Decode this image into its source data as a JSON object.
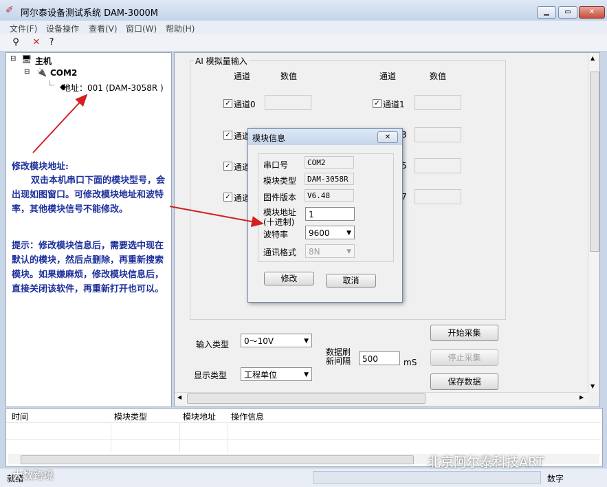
{
  "window": {
    "title": "阿尔泰设备测试系统 DAM-3000M"
  },
  "menu": [
    "文件(F)",
    "设备操作",
    "查看(V)",
    "窗口(W)",
    "帮助(H)"
  ],
  "tree": {
    "root": "主机",
    "port": "COM2",
    "device": "地址：001 (DAM-3058R )"
  },
  "annotation": {
    "title": "修改模块地址:",
    "body": "双击本机串口下面的模块型号，会出现如图窗口。可修改模块地址和波特率，其他模块信号不能修改。",
    "tip": "提示：修改模块信息后，需要选中现在默认的模块，然后点删除，再重新搜索模块。如果嫌麻烦，修改模块信息后，直接关闭该软件，再重新打开也可以。"
  },
  "ai": {
    "group_title": "AI 模拟量输入",
    "col_channel": "通道",
    "col_value": "数值",
    "left_channels": [
      "通道0",
      "通道",
      "通道",
      "通道"
    ],
    "right_channels": [
      "通道1",
      "3",
      "5",
      "7"
    ]
  },
  "controls": {
    "input_type_label": "输入类型",
    "input_type_value": "0～10V",
    "display_type_label": "显示类型",
    "display_type_value": "工程单位",
    "refresh_label": "数据刷新间隔",
    "refresh_value": "500",
    "refresh_unit": "mS",
    "start_button": "开始采集",
    "stop_button": "停止采集",
    "save_button": "保存数据"
  },
  "dialog": {
    "title": "模块信息",
    "port_label": "串口号",
    "port_value": "COM2",
    "type_label": "模块类型",
    "type_value": "DAM-3058R",
    "fw_label": "固件版本",
    "fw_value": "V6.48",
    "addr_label": "模块地址",
    "addr_label2": "(十进制)",
    "addr_value": "1",
    "baud_label": "波特率",
    "baud_value": "9600",
    "format_label": "通讯格式",
    "format_value": "8N",
    "modify_button": "修改",
    "cancel_button": "取消"
  },
  "log": {
    "columns": [
      "时间",
      "模块类型",
      "模块地址",
      "操作信息"
    ]
  },
  "status": {
    "left": "就绪",
    "right": "数字"
  },
  "watermark": "北京阿尔泰科技ART",
  "watermark2": "大数跨境",
  "colors": {
    "annotation_text": "#1d2f9c",
    "arrow": "#d42020"
  }
}
